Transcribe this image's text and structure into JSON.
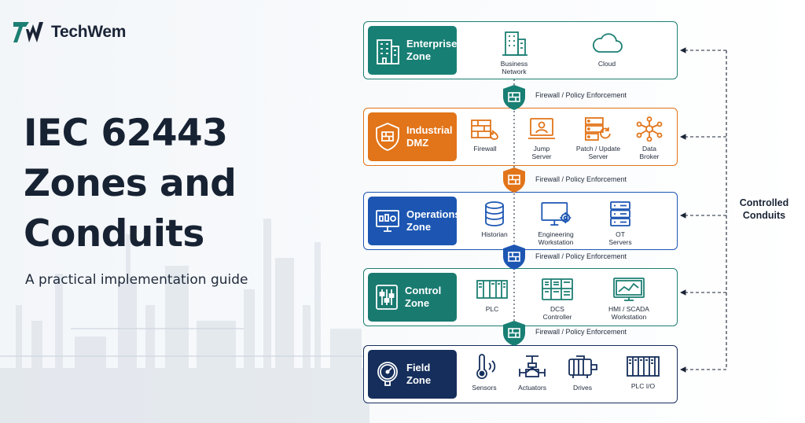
{
  "brand": {
    "name": "TechWem"
  },
  "hero": {
    "title_lines": [
      "IEC 62443",
      "Zones and",
      "Conduits"
    ],
    "subtitle": "A practical implementation guide"
  },
  "colors": {
    "enterprise": "#187f74",
    "dmz": "#e27419",
    "operations": "#1c56b2",
    "control": "#197a70",
    "field": "#152e5b",
    "text": "#1a2436"
  },
  "zones": [
    {
      "title_lines": [
        "Enterprise",
        "Zone"
      ],
      "icon": "building-icon",
      "components": [
        {
          "icon": "business-building-icon",
          "label_lines": [
            "Business",
            "Network"
          ]
        },
        {
          "icon": "cloud-icon",
          "label_lines": [
            "Cloud"
          ]
        }
      ]
    },
    {
      "title_lines": [
        "Industrial",
        "DMZ"
      ],
      "icon": "firewall-shield-icon",
      "components": [
        {
          "icon": "firewall-icon",
          "label_lines": [
            "Firewall"
          ]
        },
        {
          "icon": "jump-server-icon",
          "label_lines": [
            "Jump",
            "Server"
          ]
        },
        {
          "icon": "patch-server-icon",
          "label_lines": [
            "Patch / Update",
            "Server"
          ]
        },
        {
          "icon": "data-broker-icon",
          "label_lines": [
            "Data",
            "Broker"
          ]
        }
      ]
    },
    {
      "title_lines": [
        "Operations",
        "Zone"
      ],
      "icon": "monitor-icon",
      "components": [
        {
          "icon": "database-icon",
          "label_lines": [
            "Historian"
          ]
        },
        {
          "icon": "engineering-workstation-icon",
          "label_lines": [
            "Engineering",
            "Workstation"
          ]
        },
        {
          "icon": "server-rack-icon",
          "label_lines": [
            "OT",
            "Servers"
          ]
        }
      ]
    },
    {
      "title_lines": [
        "Control",
        "Zone"
      ],
      "icon": "control-panel-icon",
      "components": [
        {
          "icon": "plc-icon",
          "label_lines": [
            "PLC"
          ]
        },
        {
          "icon": "dcs-controller-icon",
          "label_lines": [
            "DCS",
            "Controller"
          ]
        },
        {
          "icon": "hmi-icon",
          "label_lines": [
            "HMI / SCADA",
            "Workstation"
          ]
        }
      ]
    },
    {
      "title_lines": [
        "Field",
        "Zone"
      ],
      "icon": "gauge-icon",
      "components": [
        {
          "icon": "sensor-icon",
          "label_lines": [
            "Sensors"
          ]
        },
        {
          "icon": "actuator-valve-icon",
          "label_lines": [
            "Actuators"
          ]
        },
        {
          "icon": "motor-drive-icon",
          "label_lines": [
            "Drives"
          ]
        },
        {
          "icon": "plc-io-icon",
          "label_lines": [
            "PLC I/O"
          ]
        }
      ]
    }
  ],
  "conduits": [
    {
      "label": "Firewall / Policy Enforcement"
    },
    {
      "label": "Firewall / Policy Enforcement"
    },
    {
      "label": "Firewall / Policy Enforcement"
    },
    {
      "label": "Firewall / Policy Enforcement"
    }
  ],
  "controlled_conduits": {
    "label_lines": [
      "Controlled",
      "Conduits"
    ]
  }
}
